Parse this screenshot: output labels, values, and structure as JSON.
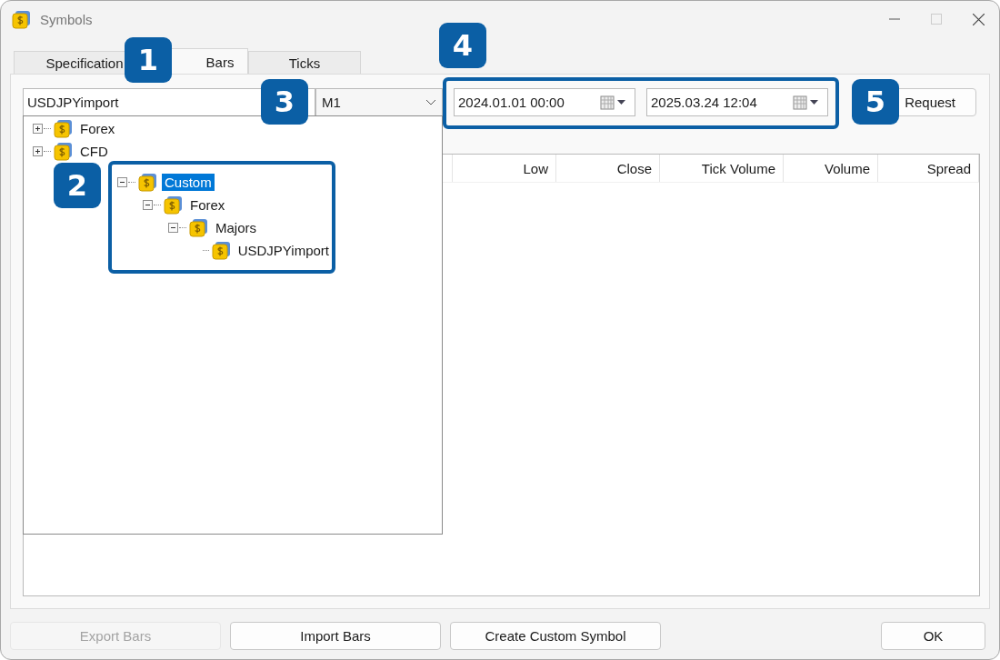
{
  "window": {
    "title": "Symbols"
  },
  "tabs": [
    {
      "label": "Specification",
      "selected": false
    },
    {
      "label": "Bars",
      "selected": true
    },
    {
      "label": "Ticks",
      "selected": false
    }
  ],
  "symbol_field": {
    "value": "USDJPYimport"
  },
  "timeframe": {
    "value": "M1"
  },
  "date_from": {
    "value": "2024.01.01 00:00"
  },
  "date_to": {
    "value": "2025.03.24 12:04"
  },
  "request_button": {
    "label": "Request"
  },
  "table": {
    "columns": [
      "Low",
      "Close",
      "Tick Volume",
      "Volume",
      "Spread"
    ]
  },
  "symbol_tree": [
    {
      "label": "Forex",
      "expanded": false,
      "selected": false
    },
    {
      "label": "CFD",
      "expanded": false,
      "selected": false
    }
  ],
  "zoom_inset": {
    "tree": [
      {
        "label": "Custom",
        "expanded": true,
        "selected": true,
        "children": [
          {
            "label": "Forex",
            "expanded": true,
            "selected": false,
            "children": [
              {
                "label": "Majors",
                "expanded": true,
                "selected": false,
                "children": [
                  {
                    "label": "USDJPYimport",
                    "selected": false
                  }
                ]
              }
            ]
          }
        ]
      }
    ]
  },
  "callouts": [
    {
      "number": "1"
    },
    {
      "number": "2"
    },
    {
      "number": "3"
    },
    {
      "number": "4"
    },
    {
      "number": "5"
    }
  ],
  "buttons": [
    {
      "label": "Export Bars",
      "disabled": true
    },
    {
      "label": "Import Bars",
      "disabled": false
    },
    {
      "label": "Create Custom Symbol",
      "disabled": false
    }
  ],
  "ok_button": {
    "label": "OK",
    "disabled": false
  }
}
